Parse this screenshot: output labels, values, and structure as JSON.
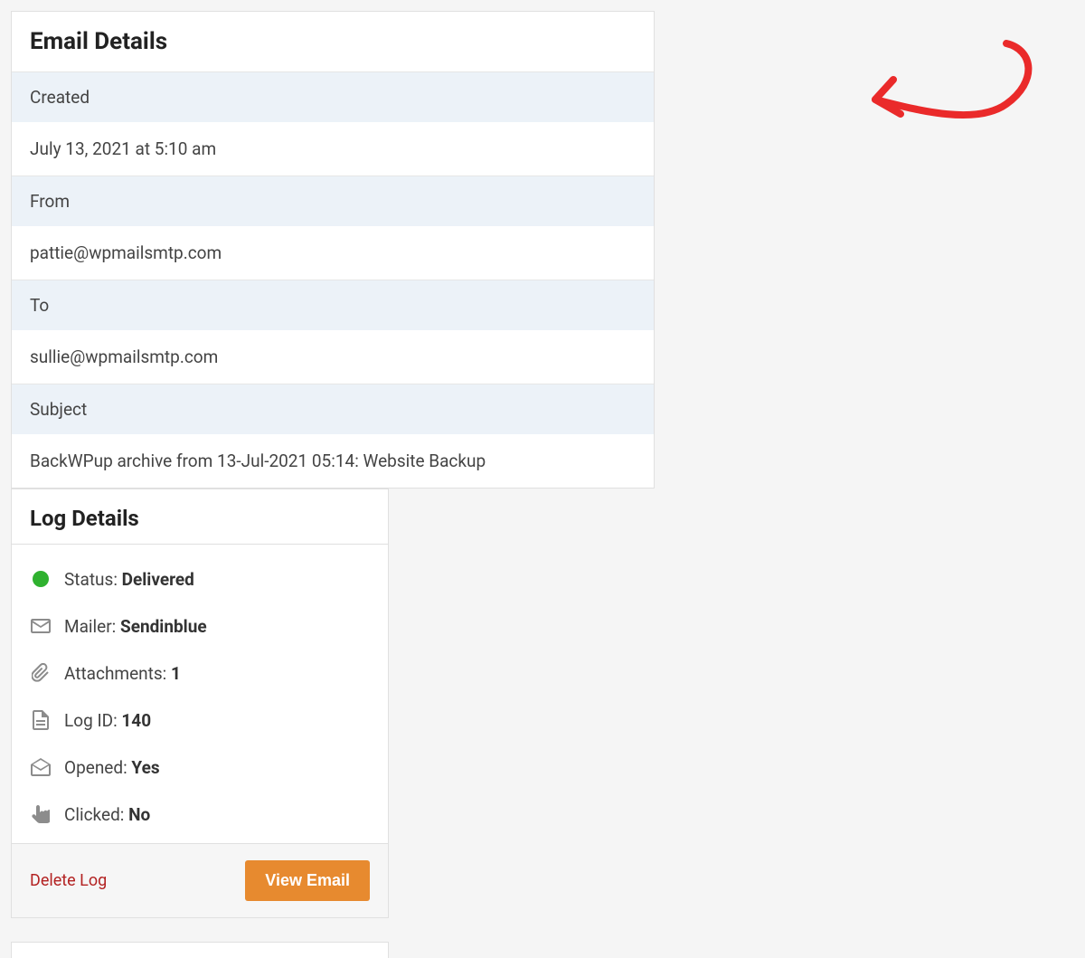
{
  "email_details": {
    "title": "Email Details",
    "created_label": "Created",
    "created_value": "July 13, 2021 at 5:10 am",
    "from_label": "From",
    "from_value": "pattie@wpmailsmtp.com",
    "to_label": "To",
    "to_value": "sullie@wpmailsmtp.com",
    "subject_label": "Subject",
    "subject_value": "BackWPup archive from 13-Jul-2021 05:14: Website Backup"
  },
  "log_details": {
    "title": "Log Details",
    "status_label": "Status: ",
    "status_value": "Delivered",
    "mailer_label": "Mailer: ",
    "mailer_value": "Sendinblue",
    "attachments_label": "Attachments: ",
    "attachments_value": "1",
    "logid_label": "Log ID: ",
    "logid_value": "140",
    "opened_label": "Opened: ",
    "opened_value": "Yes",
    "clicked_label": "Clicked: ",
    "clicked_value": "No",
    "delete_label": "Delete Log",
    "view_label": "View Email"
  },
  "colors": {
    "status_green": "#2fb12f",
    "delete_red": "#b32222",
    "view_orange": "#e78a2f",
    "annotation_red": "#ea2a2a"
  }
}
